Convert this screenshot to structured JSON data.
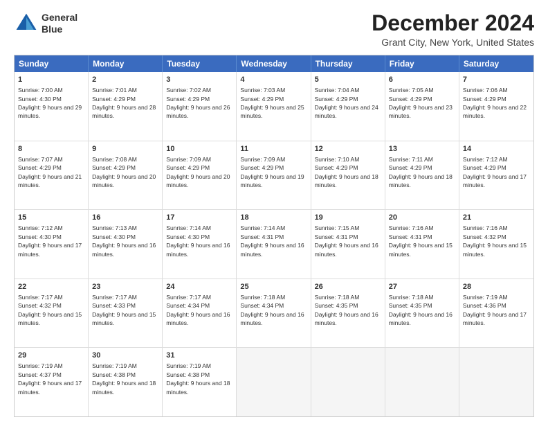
{
  "header": {
    "logo_line1": "General",
    "logo_line2": "Blue",
    "title": "December 2024",
    "subtitle": "Grant City, New York, United States"
  },
  "weekdays": [
    "Sunday",
    "Monday",
    "Tuesday",
    "Wednesday",
    "Thursday",
    "Friday",
    "Saturday"
  ],
  "weeks": [
    [
      {
        "day": "1",
        "sunrise": "Sunrise: 7:00 AM",
        "sunset": "Sunset: 4:30 PM",
        "daylight": "Daylight: 9 hours and 29 minutes."
      },
      {
        "day": "2",
        "sunrise": "Sunrise: 7:01 AM",
        "sunset": "Sunset: 4:29 PM",
        "daylight": "Daylight: 9 hours and 28 minutes."
      },
      {
        "day": "3",
        "sunrise": "Sunrise: 7:02 AM",
        "sunset": "Sunset: 4:29 PM",
        "daylight": "Daylight: 9 hours and 26 minutes."
      },
      {
        "day": "4",
        "sunrise": "Sunrise: 7:03 AM",
        "sunset": "Sunset: 4:29 PM",
        "daylight": "Daylight: 9 hours and 25 minutes."
      },
      {
        "day": "5",
        "sunrise": "Sunrise: 7:04 AM",
        "sunset": "Sunset: 4:29 PM",
        "daylight": "Daylight: 9 hours and 24 minutes."
      },
      {
        "day": "6",
        "sunrise": "Sunrise: 7:05 AM",
        "sunset": "Sunset: 4:29 PM",
        "daylight": "Daylight: 9 hours and 23 minutes."
      },
      {
        "day": "7",
        "sunrise": "Sunrise: 7:06 AM",
        "sunset": "Sunset: 4:29 PM",
        "daylight": "Daylight: 9 hours and 22 minutes."
      }
    ],
    [
      {
        "day": "8",
        "sunrise": "Sunrise: 7:07 AM",
        "sunset": "Sunset: 4:29 PM",
        "daylight": "Daylight: 9 hours and 21 minutes."
      },
      {
        "day": "9",
        "sunrise": "Sunrise: 7:08 AM",
        "sunset": "Sunset: 4:29 PM",
        "daylight": "Daylight: 9 hours and 20 minutes."
      },
      {
        "day": "10",
        "sunrise": "Sunrise: 7:09 AM",
        "sunset": "Sunset: 4:29 PM",
        "daylight": "Daylight: 9 hours and 20 minutes."
      },
      {
        "day": "11",
        "sunrise": "Sunrise: 7:09 AM",
        "sunset": "Sunset: 4:29 PM",
        "daylight": "Daylight: 9 hours and 19 minutes."
      },
      {
        "day": "12",
        "sunrise": "Sunrise: 7:10 AM",
        "sunset": "Sunset: 4:29 PM",
        "daylight": "Daylight: 9 hours and 18 minutes."
      },
      {
        "day": "13",
        "sunrise": "Sunrise: 7:11 AM",
        "sunset": "Sunset: 4:29 PM",
        "daylight": "Daylight: 9 hours and 18 minutes."
      },
      {
        "day": "14",
        "sunrise": "Sunrise: 7:12 AM",
        "sunset": "Sunset: 4:29 PM",
        "daylight": "Daylight: 9 hours and 17 minutes."
      }
    ],
    [
      {
        "day": "15",
        "sunrise": "Sunrise: 7:12 AM",
        "sunset": "Sunset: 4:30 PM",
        "daylight": "Daylight: 9 hours and 17 minutes."
      },
      {
        "day": "16",
        "sunrise": "Sunrise: 7:13 AM",
        "sunset": "Sunset: 4:30 PM",
        "daylight": "Daylight: 9 hours and 16 minutes."
      },
      {
        "day": "17",
        "sunrise": "Sunrise: 7:14 AM",
        "sunset": "Sunset: 4:30 PM",
        "daylight": "Daylight: 9 hours and 16 minutes."
      },
      {
        "day": "18",
        "sunrise": "Sunrise: 7:14 AM",
        "sunset": "Sunset: 4:31 PM",
        "daylight": "Daylight: 9 hours and 16 minutes."
      },
      {
        "day": "19",
        "sunrise": "Sunrise: 7:15 AM",
        "sunset": "Sunset: 4:31 PM",
        "daylight": "Daylight: 9 hours and 16 minutes."
      },
      {
        "day": "20",
        "sunrise": "Sunrise: 7:16 AM",
        "sunset": "Sunset: 4:31 PM",
        "daylight": "Daylight: 9 hours and 15 minutes."
      },
      {
        "day": "21",
        "sunrise": "Sunrise: 7:16 AM",
        "sunset": "Sunset: 4:32 PM",
        "daylight": "Daylight: 9 hours and 15 minutes."
      }
    ],
    [
      {
        "day": "22",
        "sunrise": "Sunrise: 7:17 AM",
        "sunset": "Sunset: 4:32 PM",
        "daylight": "Daylight: 9 hours and 15 minutes."
      },
      {
        "day": "23",
        "sunrise": "Sunrise: 7:17 AM",
        "sunset": "Sunset: 4:33 PM",
        "daylight": "Daylight: 9 hours and 15 minutes."
      },
      {
        "day": "24",
        "sunrise": "Sunrise: 7:17 AM",
        "sunset": "Sunset: 4:34 PM",
        "daylight": "Daylight: 9 hours and 16 minutes."
      },
      {
        "day": "25",
        "sunrise": "Sunrise: 7:18 AM",
        "sunset": "Sunset: 4:34 PM",
        "daylight": "Daylight: 9 hours and 16 minutes."
      },
      {
        "day": "26",
        "sunrise": "Sunrise: 7:18 AM",
        "sunset": "Sunset: 4:35 PM",
        "daylight": "Daylight: 9 hours and 16 minutes."
      },
      {
        "day": "27",
        "sunrise": "Sunrise: 7:18 AM",
        "sunset": "Sunset: 4:35 PM",
        "daylight": "Daylight: 9 hours and 16 minutes."
      },
      {
        "day": "28",
        "sunrise": "Sunrise: 7:19 AM",
        "sunset": "Sunset: 4:36 PM",
        "daylight": "Daylight: 9 hours and 17 minutes."
      }
    ],
    [
      {
        "day": "29",
        "sunrise": "Sunrise: 7:19 AM",
        "sunset": "Sunset: 4:37 PM",
        "daylight": "Daylight: 9 hours and 17 minutes."
      },
      {
        "day": "30",
        "sunrise": "Sunrise: 7:19 AM",
        "sunset": "Sunset: 4:38 PM",
        "daylight": "Daylight: 9 hours and 18 minutes."
      },
      {
        "day": "31",
        "sunrise": "Sunrise: 7:19 AM",
        "sunset": "Sunset: 4:38 PM",
        "daylight": "Daylight: 9 hours and 18 minutes."
      },
      {
        "day": "",
        "sunrise": "",
        "sunset": "",
        "daylight": ""
      },
      {
        "day": "",
        "sunrise": "",
        "sunset": "",
        "daylight": ""
      },
      {
        "day": "",
        "sunrise": "",
        "sunset": "",
        "daylight": ""
      },
      {
        "day": "",
        "sunrise": "",
        "sunset": "",
        "daylight": ""
      }
    ]
  ]
}
